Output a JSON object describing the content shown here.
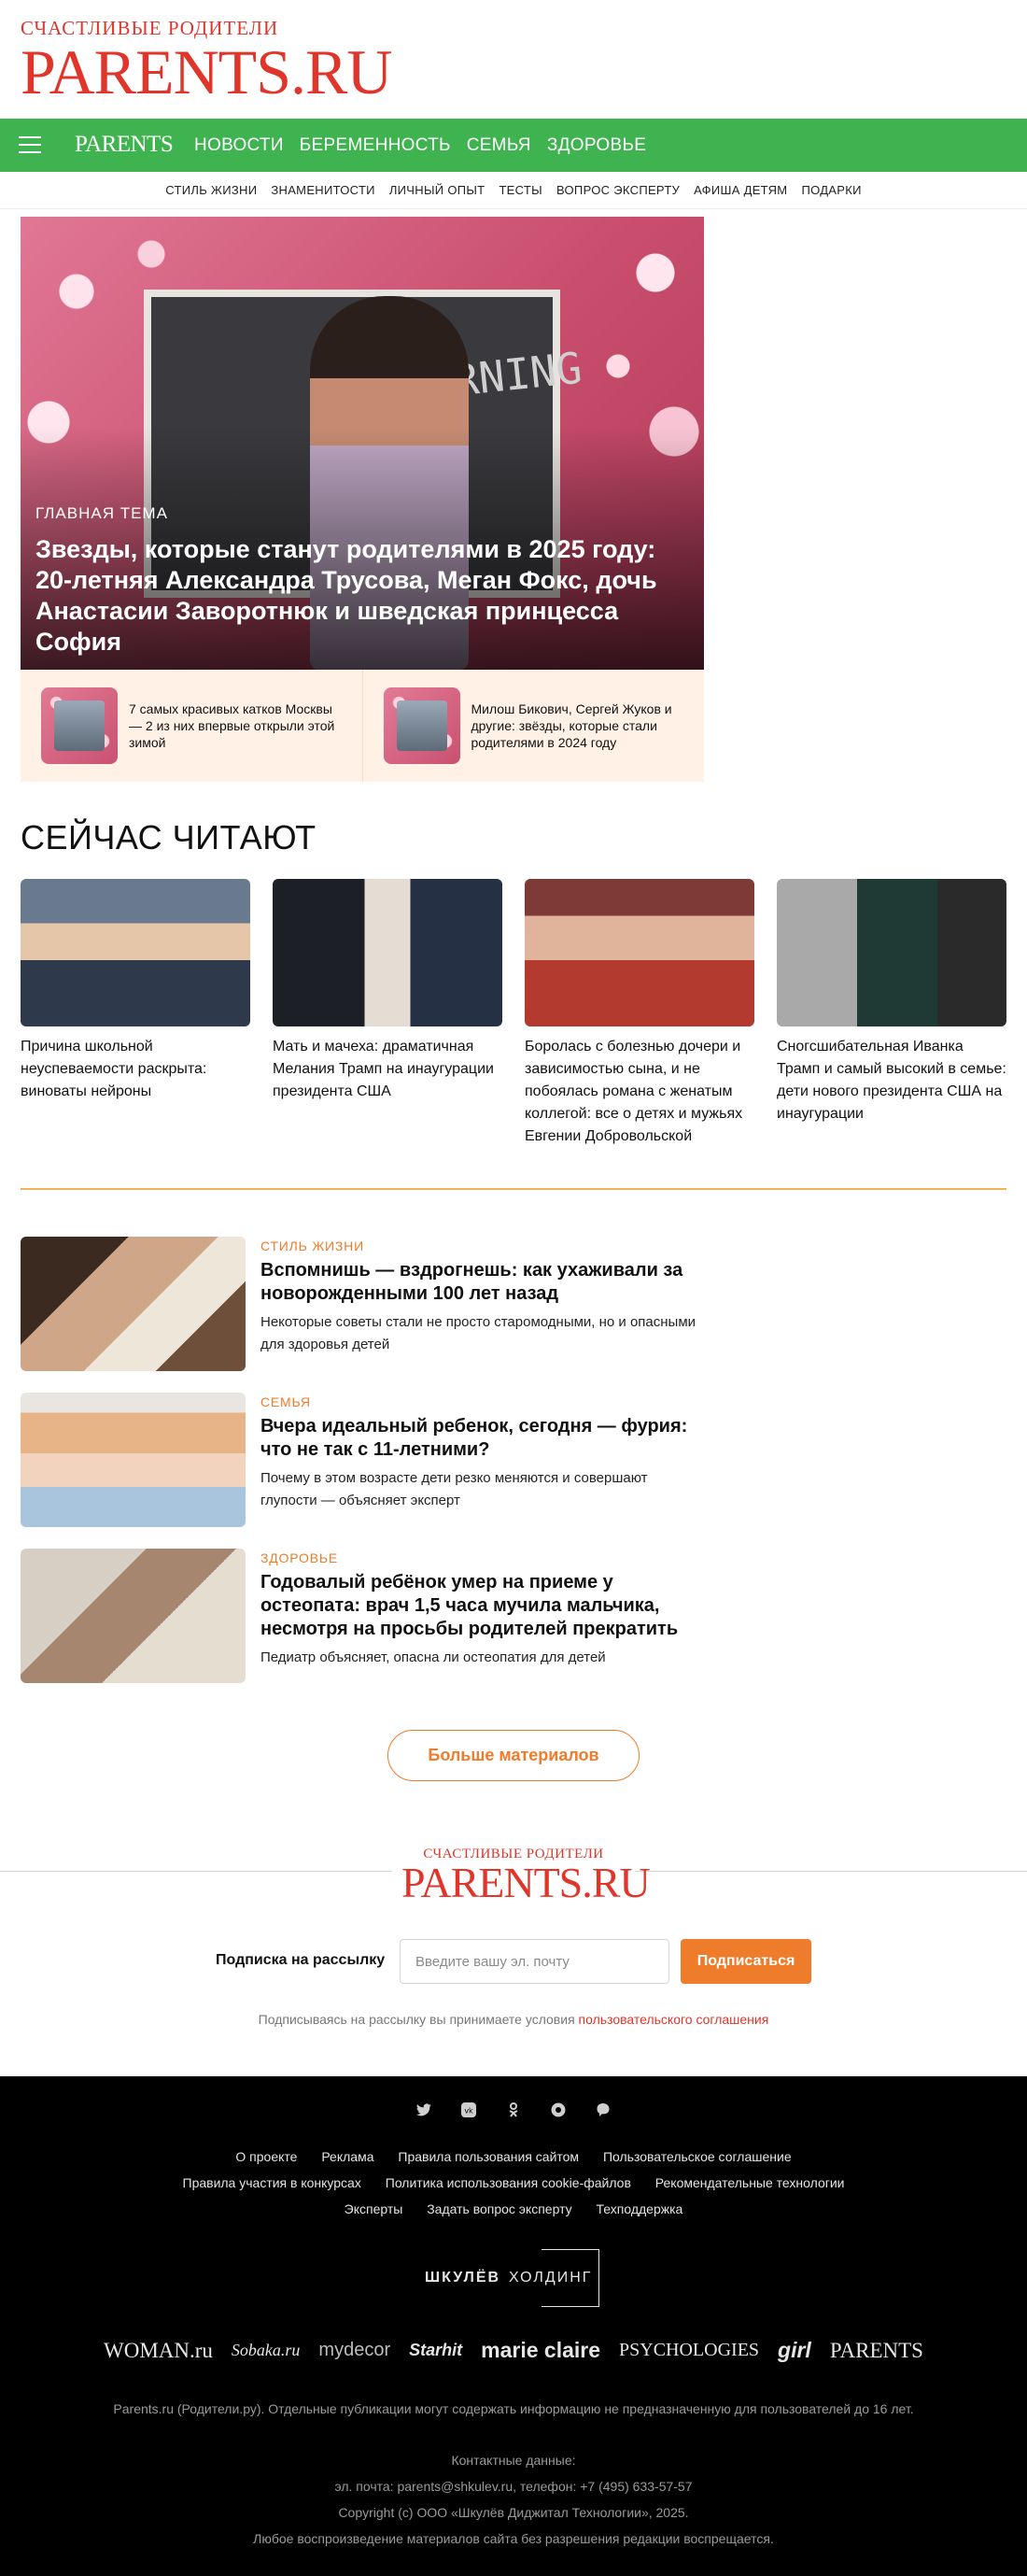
{
  "logo": {
    "small": "СЧАСТЛИВЫЕ РОДИТЕЛИ",
    "big": "PARENTS.RU"
  },
  "nav": {
    "logo": "PARENTS",
    "items": [
      "НОВОСТИ",
      "БЕРЕМЕННОСТЬ",
      "СЕМЬЯ",
      "ЗДОРОВЬЕ"
    ]
  },
  "subnav": [
    "СТИЛЬ ЖИЗНИ",
    "ЗНАМЕНИТОСТИ",
    "ЛИЧНЫЙ ОПЫТ",
    "ТЕСТЫ",
    "ВОПРОС ЭКСПЕРТУ",
    "АФИША ДЕТЯМ",
    "ПОДАРКИ"
  ],
  "hero": {
    "board_text": "MOURNING",
    "kicker": "ГЛАВНАЯ ТЕМА",
    "title": "Звезды, которые станут родителями в 2025 году: 20-летняя Александра Трусова, Меган Фокс, дочь Анастасии Заворотнюк и шведская принцесса София",
    "subcards": [
      {
        "title": "7 самых красивых катков Москвы — 2 из них впервые открыли этой зимой"
      },
      {
        "title": "Милош Бикович, Сергей Жуков и другие: звёзды, которые стали родителями в 2024 году"
      }
    ]
  },
  "now_reading": {
    "title": "СЕЙЧАС ЧИТАЮТ",
    "cards": [
      {
        "title": "Причина школьной неуспеваемости раскрыта: виноваты нейроны"
      },
      {
        "title": "Мать и мачеха: драматичная Мелания Трамп на инаугурации президента США"
      },
      {
        "title": "Боролась с болезнью дочери и зависимостью сына, и не побоялась романа с женатым коллегой: все о детях и мужьях Евгении Добровольской"
      },
      {
        "title": "Сногсшибательная Иванка Трамп и самый высокий в семье: дети нового президента США на инаугурации"
      }
    ]
  },
  "articles": [
    {
      "category": "СТИЛЬ ЖИЗНИ",
      "title": "Вспомнишь — вздрогнешь: как ухаживали за новорожденными 100 лет назад",
      "desc": "Некоторые советы стали не просто старомодными, но и опасными для здоровья детей"
    },
    {
      "category": "СЕМЬЯ",
      "title": "Вчера идеальный ребенок, сегодня — фурия: что не так с 11-летними?",
      "desc": "Почему в этом возрасте дети резко меняются и совершают глупости — объясняет эксперт"
    },
    {
      "category": "ЗДОРОВЬЕ",
      "title": "Годовалый ребёнок умер на приеме у остеопата: врач 1,5 часа мучила мальчика, несмотря на просьбы родителей прекратить",
      "desc": "Педиатр объясняет, опасна ли остеопатия для детей"
    }
  ],
  "more_button": "Больше материалов",
  "newsletter": {
    "label": "Подписка на рассылку",
    "placeholder": "Введите вашу эл. почту",
    "button": "Подписаться",
    "note": "Подписываясь на рассылку вы принимаете условия",
    "note_link": "пользовательского соглашения"
  },
  "footer": {
    "social_icons": [
      "twitter-icon",
      "vk-icon",
      "ok-icon",
      "odnoklassniki-icon",
      "viber-icon"
    ],
    "links_row1": [
      "О проекте",
      "Реклама",
      "Правила пользования сайтом",
      "Пользовательское соглашение"
    ],
    "links_row2": [
      "Правила участия в конкурсах",
      "Политика использования cookie-файлов",
      "Рекомендательные технологии"
    ],
    "links_row3": [
      "Эксперты",
      "Задать вопрос эксперту",
      "Техподдержка"
    ],
    "holding_word1": "ШКУЛЁВ",
    "holding_word2": "ХОЛДИНГ",
    "brands": [
      "WOMAN.ru",
      "Sobaka.ru",
      "mydecor",
      "Starhit",
      "marie claire",
      "PSYCHOLOGIES",
      "girl",
      "PARENTS"
    ],
    "notice": "Parents.ru (Родители.ру). Отдельные публикации могут содержать информацию не предназначенную для пользователей до 16 лет.",
    "contacts_title": "Контактные данные:",
    "contacts": "эл. почта: parents@shkulev.ru, телефон: +7 (495) 633-57-57",
    "copyright": "Copyright (c) ООО «Шкулёв Диджитал Технологии», 2025.",
    "reprint": "Любое воспроизведение материалов сайта без разрешения редакции воспрещается."
  },
  "colors": {
    "green": "#3fb350",
    "brand_red": "#e0352b",
    "accent_orange": "#ef7c2a"
  }
}
